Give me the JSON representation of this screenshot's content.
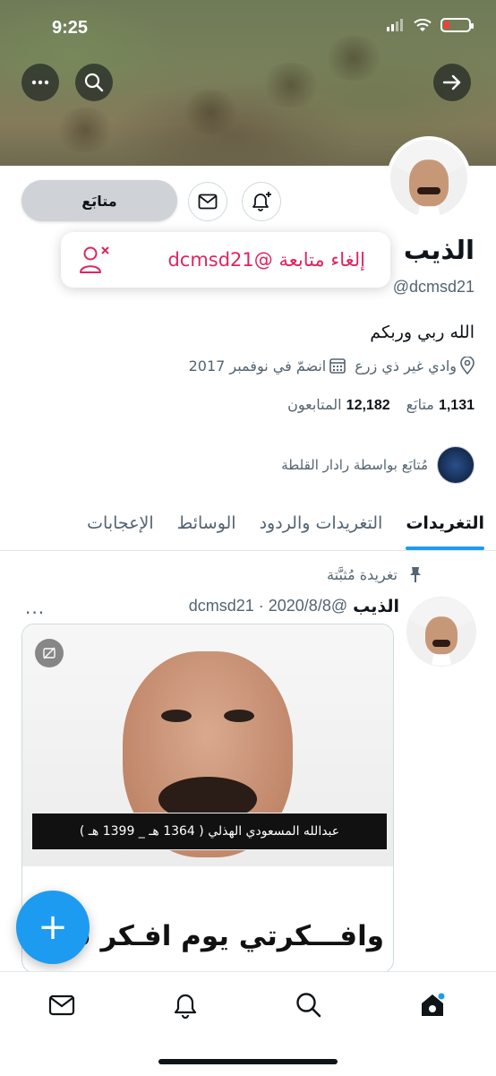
{
  "status_bar": {
    "time": "9:25"
  },
  "header": {
    "back_icon": "arrow-right-icon",
    "search_icon": "search-icon",
    "more_icon": "more-icon"
  },
  "profile": {
    "follow_button": "متابَع",
    "name": "الذيب",
    "handle": "@dcmsd21",
    "bio": "الله ربي وربكم",
    "location": "وادي غير ذي زرع",
    "joined": "انضمّ في نوفمبر 2017",
    "following_count": "1,131",
    "following_label": "متابَع",
    "followers_count": "12,182",
    "followers_label": "المتابعون",
    "followed_by": "مُتابَع بواسطة رادار القلطة"
  },
  "popup": {
    "text": "إلغاء متابعة @dcmsd21"
  },
  "tabs": [
    {
      "label": "التغريدات",
      "active": true
    },
    {
      "label": "التغريدات والردود",
      "active": false
    },
    {
      "label": "الوسائط",
      "active": false
    },
    {
      "label": "الإعجابات",
      "active": false
    }
  ],
  "tweet": {
    "pinned_label": "تغريدة مُثبَّتة",
    "author": "الذيب",
    "handle_date": "@dcmsd21 · 2020/8/8",
    "more": "···",
    "media_caption": "عبدالله المسعودي الهذلي  ( 1364 هـ _ 1399 هـ )",
    "media_text": "وافـــكرتي يوم افـكر في كثـــير الامور"
  },
  "fab": {
    "label": "+"
  },
  "colors": {
    "accent": "#1d9bf0",
    "danger": "#e0245e"
  }
}
